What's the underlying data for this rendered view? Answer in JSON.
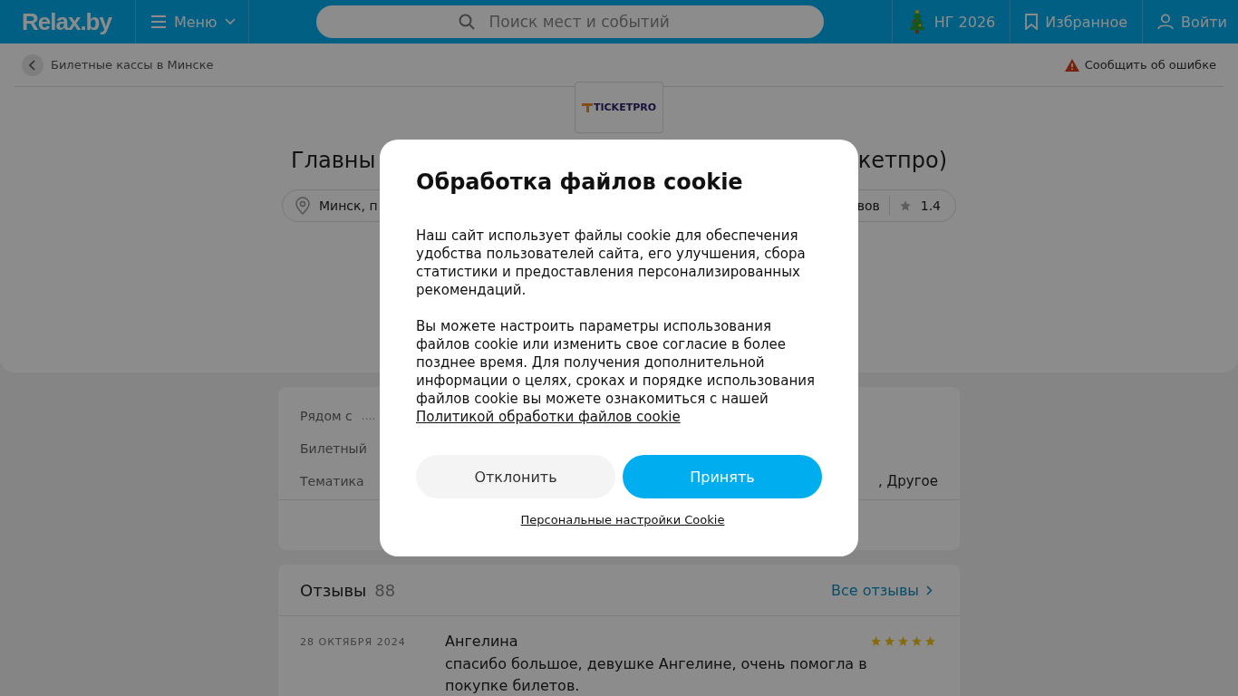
{
  "header": {
    "logo": "Relax.by",
    "menu": "Меню",
    "search": {
      "placeholder": "Поиск мест и событий"
    },
    "links": [
      {
        "kind": "tree",
        "label": "НГ 2026"
      },
      {
        "kind": "bookmark",
        "label": "Избранное"
      },
      {
        "kind": "user",
        "label": "Войти"
      }
    ]
  },
  "breadcrumb": {
    "back": "Билетные кассы в Минске",
    "report": "Сообщить об ошибке"
  },
  "place": {
    "logo": "TICKETPRO",
    "title_left": "Главны",
    "title_right": "кетпро)",
    "address": "Минск, п",
    "reviews_tail": "вов",
    "rating": "1.4"
  },
  "info": {
    "rows": [
      {
        "label": "Рядом с",
        "value": "....",
        "tail": ""
      },
      {
        "label": "Билетный",
        "value": "",
        "tail": ""
      },
      {
        "label": "Тематика",
        "value": "",
        "tail": ", Другое"
      }
    ]
  },
  "reviews": {
    "title": "Отзывы",
    "count": "88",
    "all": "Все отзывы",
    "items": [
      {
        "date": "28 ОКТЯБРЯ 2024",
        "author": "Ангелина",
        "stars": 5,
        "text": "спасибо большое, девушке Ангелине, очень помогла в покупке билетов."
      }
    ]
  },
  "cookie": {
    "title": "Обработка файлов cookie",
    "paragraphs": [
      "Наш сайт использует файлы cookie для обеспечения удобства пользователей сайта, его улучшения, сбора статистики и предоставления персонализированных рекомендаций.",
      "Вы можете настроить параметры использования файлов cookie или изменить свое согласие в более позднее время. Для получения дополнительной информации о целях, сроках и порядке использования файлов cookie вы можете ознакомиться с нашей"
    ],
    "policy_link": "Политикой обработки файлов cookie",
    "decline": "Отклонить",
    "accept": "Принять",
    "settings": "Персональные настройки Cookie"
  }
}
